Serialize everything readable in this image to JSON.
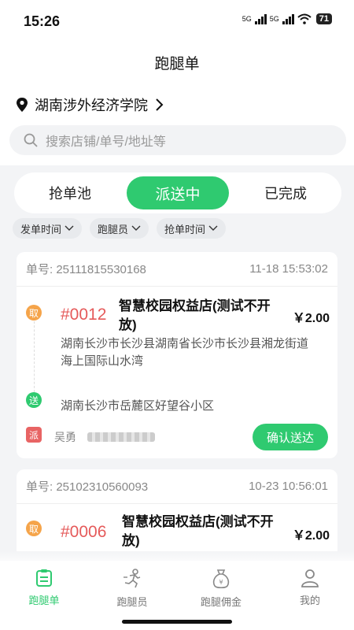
{
  "status_bar": {
    "time": "15:26",
    "network1": "5G",
    "network2": "5G",
    "battery": "71"
  },
  "header": {
    "title": "跑腿单"
  },
  "location": {
    "name": "湖南涉外经济学院",
    "chevron": "›"
  },
  "search": {
    "placeholder": "搜索店铺/单号/地址等"
  },
  "tabs": [
    {
      "label": "抢单池"
    },
    {
      "label": "派送中"
    },
    {
      "label": "已完成"
    }
  ],
  "filters": [
    {
      "label": "发单时间"
    },
    {
      "label": "跑腿员"
    },
    {
      "label": "抢单时间"
    }
  ],
  "orders": [
    {
      "number_label": "单号: 25111815530168",
      "time": "11-18 15:53:02",
      "pickup_badge": "取",
      "order_tag": "#0012",
      "shop_line1": "智慧校园权益店(测试不开",
      "shop_line2": "放)",
      "price": "￥2.00",
      "pickup_line1": "湖南长沙市长沙县湖南省长沙市长沙县湘龙街道",
      "pickup_line2": "海上国际山水湾",
      "deliver_badge": "送",
      "deliver_address": "湖南长沙市岳麓区好望谷小区",
      "dispatch_badge": "派",
      "rider_name": "吴勇",
      "confirm_label": "确认送达"
    },
    {
      "number_label": "单号: 25102310560093",
      "time": "10-23 10:56:01",
      "pickup_badge": "取",
      "order_tag": "#0006",
      "shop_line1": "智慧校园权益店(测试不开",
      "shop_line2": "放)",
      "price": "￥2.00"
    }
  ],
  "bottom_nav": [
    {
      "label": "跑腿单",
      "icon": "clipboard-icon",
      "active": true
    },
    {
      "label": "跑腿员",
      "icon": "runner-icon",
      "active": false
    },
    {
      "label": "跑腿佣金",
      "icon": "money-bag-icon",
      "active": false
    },
    {
      "label": "我的",
      "icon": "user-icon",
      "active": false
    }
  ],
  "colors": {
    "accent": "#2fca70",
    "order_tag": "#e55a5a",
    "pickup": "#f5a44a",
    "dispatch": "#e86464"
  }
}
